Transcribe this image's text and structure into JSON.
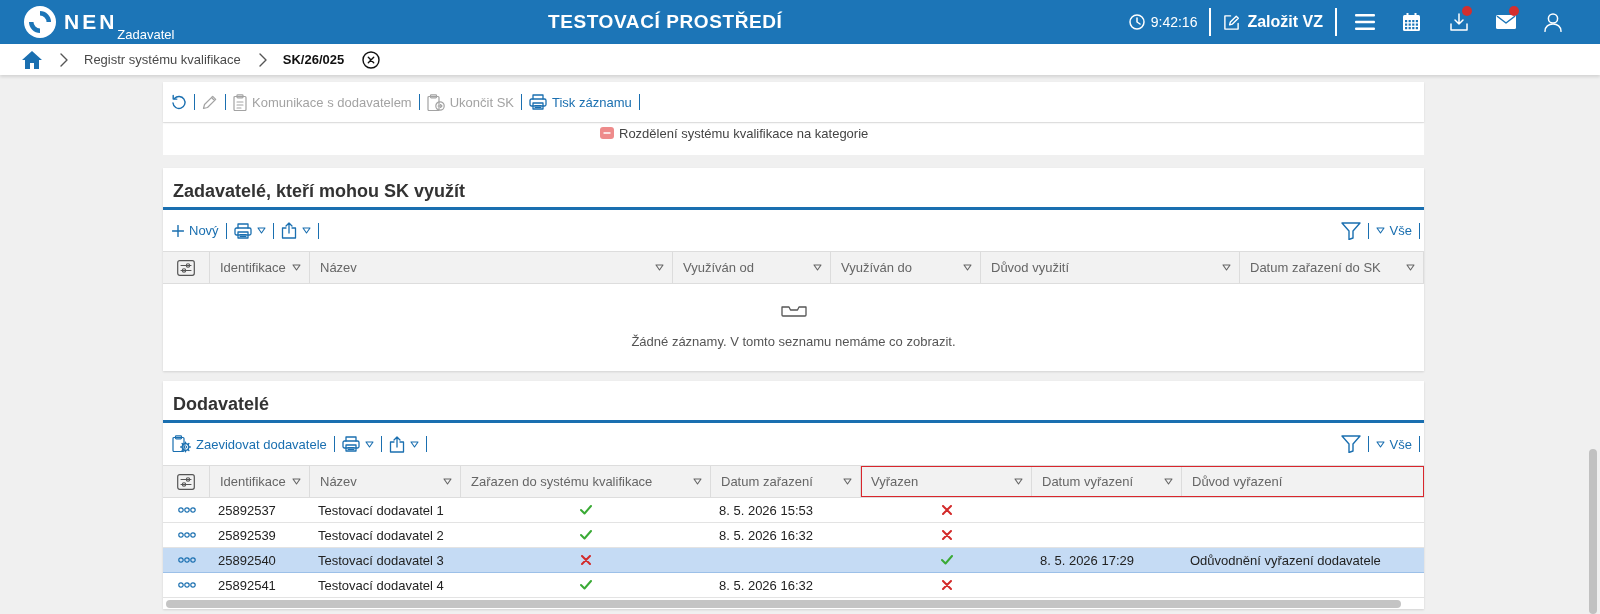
{
  "header": {
    "logo_text": "NEN",
    "logo_subtitle": "Zadavatel",
    "environment": "TESTOVACÍ PROSTŘEDÍ",
    "time": "9:42:16",
    "create_label": "Založit VZ",
    "icons": [
      {
        "badge": false
      },
      {
        "badge": false
      },
      {
        "badge": true
      },
      {
        "badge": true
      },
      {
        "badge": false
      }
    ]
  },
  "breadcrumb": {
    "items": [
      {
        "label": "Registr systému kvalifikace",
        "current": false
      },
      {
        "label": "SK/26/025",
        "current": true
      }
    ]
  },
  "toolbar": {
    "items": [
      {
        "disabled": false
      },
      {
        "disabled": true
      },
      {
        "label": "Komunikace s dodavatelem",
        "disabled": true
      },
      {
        "label": "Ukončit SK",
        "disabled": true
      },
      {
        "label": "Tisk záznamu",
        "disabled": false
      }
    ]
  },
  "categories_notice": {
    "text": "Rozdělení systému kvalifikace na kategorie"
  },
  "zadavatele": {
    "title": "Zadavatelé, kteří mohou SK využít",
    "new_label": "Nový",
    "filter_label": "Vše",
    "columns": [
      {
        "label": "Identifikace",
        "sortable": true
      },
      {
        "label": "Název",
        "sortable": true
      },
      {
        "label": "Využíván od",
        "sortable": true
      },
      {
        "label": "Využíván do",
        "sortable": true
      },
      {
        "label": "Důvod využití",
        "sortable": true
      },
      {
        "label": "Datum zařazení do SK",
        "sortable": true
      }
    ],
    "empty_message": "Žádné záznamy. V tomto seznamu nemáme co zobrazit."
  },
  "dodavatele": {
    "title": "Dodavatelé",
    "add_label": "Zaevidovat dodavatele",
    "filter_label": "Vše",
    "columns": [
      {
        "label": "Identifikace",
        "sortable": true,
        "highlighted": false
      },
      {
        "label": "Název",
        "sortable": true,
        "highlighted": false
      },
      {
        "label": "Zařazen do systému kvalifikace",
        "sortable": true,
        "highlighted": false
      },
      {
        "label": "Datum zařazení",
        "sortable": true,
        "highlighted": false
      },
      {
        "label": "Vyřazen",
        "sortable": true,
        "highlighted": true
      },
      {
        "label": "Datum vyřazení",
        "sortable": true,
        "highlighted": true
      },
      {
        "label": "Důvod vyřazení",
        "sortable": false,
        "highlighted": true
      }
    ],
    "rows": [
      {
        "id": "25892537",
        "name": "Testovací dodavatel 1",
        "included": true,
        "included_date": "8. 5. 2026 15:53",
        "removed": false,
        "selected": false
      },
      {
        "id": "25892539",
        "name": "Testovací dodavatel 2",
        "included": true,
        "included_date": "8. 5. 2026 16:32",
        "removed": false,
        "selected": false
      },
      {
        "id": "25892540",
        "name": "Testovací dodavatel 3",
        "included": false,
        "removed": true,
        "removed_date": "8. 5. 2026 17:29",
        "removed_reason": "Odůvodnění vyřazení dodavatele",
        "selected": true
      },
      {
        "id": "25892541",
        "name": "Testovací dodavatel 4",
        "included": true,
        "included_date": "8. 5. 2026 16:32",
        "removed": false,
        "selected": false
      }
    ]
  }
}
